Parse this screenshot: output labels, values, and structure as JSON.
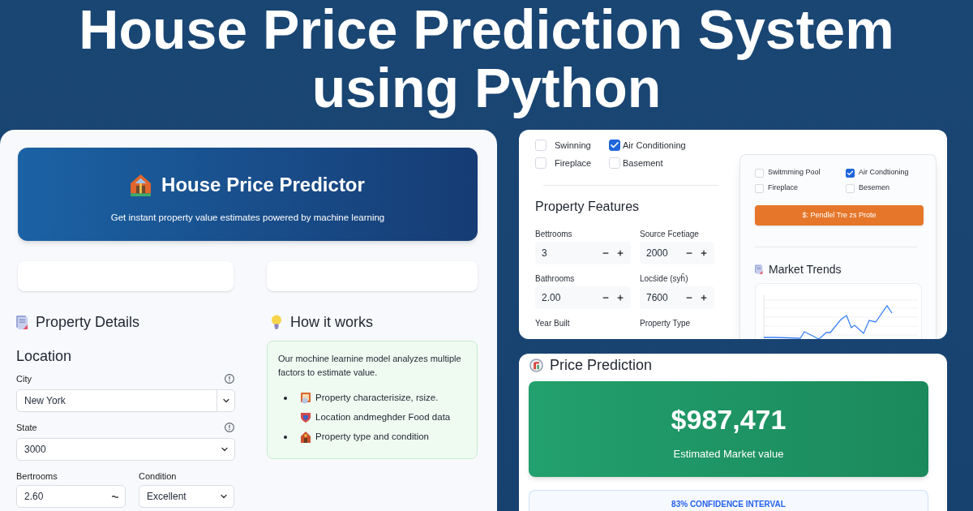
{
  "title": {
    "line_1": "House Price Prediction System",
    "line_2": "using Python"
  },
  "predictor_panel": {
    "header": {
      "title": "House Price Predictor",
      "subtitle": "Get instant property value estimates powered by machine learning"
    },
    "property_details": {
      "heading": "Property Details",
      "section": "Location",
      "fields": [
        {
          "kind": "combobox",
          "label": "City",
          "value": "New York",
          "info": true
        },
        {
          "kind": "select",
          "label": "State",
          "value": "3000",
          "info": true
        }
      ],
      "row": [
        {
          "kind": "number",
          "label": "Bertrooms",
          "value": "2.60",
          "info": false
        },
        {
          "kind": "select",
          "label": "Condition",
          "value": "Excellent",
          "info": false
        }
      ]
    },
    "how_it_works": {
      "heading": "How it works",
      "intro": "Our mochine learnine model analyzes multiple factors to estimate value.",
      "items": [
        {
          "kind": "frame",
          "text": "Property characterisize, rsize.",
          "bullet": true
        },
        {
          "kind": "shield",
          "text": "Location andmeghder Food data",
          "bullet": false
        },
        {
          "kind": "house",
          "text": "Property type and condition",
          "bullet": true
        }
      ]
    }
  },
  "features_panel": {
    "amenities": [
      {
        "label": "Swinning",
        "checked": false
      },
      {
        "label": "Air Conditioning",
        "checked": true
      },
      {
        "label": "Fireplace",
        "checked": false
      },
      {
        "label": "Basement",
        "checked": false
      }
    ],
    "heading": "Property Features",
    "inputs": [
      {
        "label": "Bettrooms",
        "value": "3"
      },
      {
        "label": "Source Fcetiage",
        "value": "2000"
      },
      {
        "label": "Bathrooms",
        "value": "2.00"
      },
      {
        "label": "Locśide (syĥ)",
        "value": "7600"
      },
      {
        "label": "Year Built"
      },
      {
        "label": "Property Type"
      }
    ],
    "options_card": {
      "amenities": [
        {
          "label": "Switmming Pool",
          "checked": false
        },
        {
          "label": "Air Condtioning",
          "checked": true
        },
        {
          "label": "Fireplace",
          "checked": false
        },
        {
          "label": "Besemen",
          "checked": false
        }
      ],
      "button": "$: Pendlel Tre zs Prote",
      "trends_heading": "Market Trends"
    }
  },
  "prediction_panel": {
    "heading": "Price Prediction",
    "price": "$987,471",
    "caption": "Estimated Market value",
    "confidence": "83% CONFIDENCE INTERVAL"
  }
}
